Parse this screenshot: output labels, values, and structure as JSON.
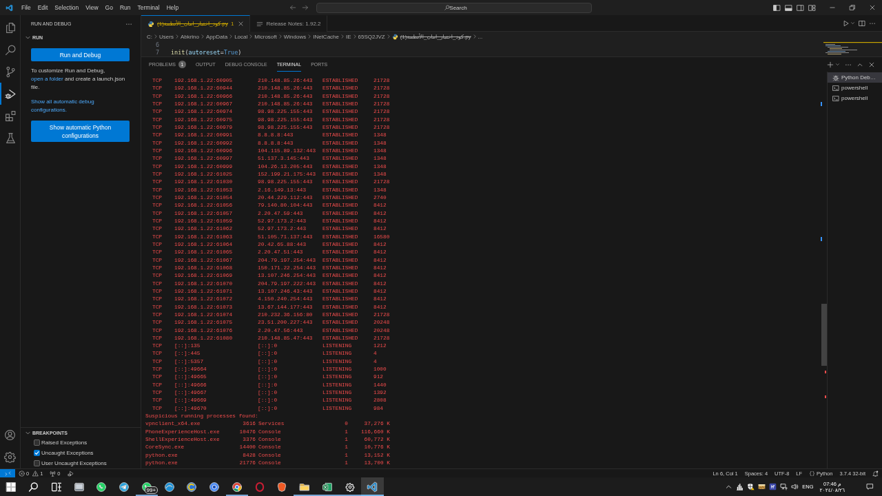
{
  "title_bar": {
    "menu": [
      "File",
      "Edit",
      "Selection",
      "View",
      "Go",
      "Run",
      "Terminal",
      "Help"
    ],
    "search": {
      "placeholder": "Search"
    }
  },
  "activity_bar": {
    "items": [
      {
        "selected": false
      },
      {
        "selected": false
      },
      {
        "selected": false
      },
      {
        "selected": true
      },
      {
        "selected": false
      },
      {
        "selected": false
      }
    ]
  },
  "sidebar": {
    "title": "RUN AND DEBUG",
    "run": {
      "title": "RUN",
      "expanded": true,
      "button": "Run and Debug",
      "intro": {
        "before": "To customize Run and Debug, ",
        "link": "open a folder",
        "after": " and create a launch.json file."
      },
      "debug_link": "Show all automatic debug configurations.",
      "python_button": "Show automatic Python configurations"
    },
    "breakpoints": {
      "title": "BREAKPOINTS",
      "expanded": true,
      "items": [
        {
          "label": "Raised Exceptions",
          "checked": false
        },
        {
          "label": "Uncaught Exceptions",
          "checked": true
        },
        {
          "label": "User Uncaught Exceptions",
          "checked": false
        }
      ]
    }
  },
  "editor": {
    "tabs": [
      {
        "kind": "file",
        "label": "كود_اختبار_امان_الأنظمة(1).py",
        "problems": "1",
        "deleted": true,
        "selected": true
      },
      {
        "kind": "preview",
        "label": "Release Notes: 1.92.2",
        "deleted": false,
        "selected": false
      }
    ],
    "breadcrumb": {
      "folders": [
        "C:",
        "Users",
        "Abkrino",
        "AppData",
        "Local",
        "Microsoft",
        "Windows",
        "INetCache",
        "IE",
        "65SQ2JVZ"
      ],
      "file": {
        "name": "كود_اختبار_امان_الأنظمة(1).py",
        "deleted": true
      },
      "symbol": "..."
    },
    "lines": [
      {
        "number": "6"
      },
      {
        "number": "7",
        "tokens": [
          {
            "kind": "function",
            "text": "init"
          },
          {
            "kind": "punctuation",
            "text": "("
          },
          {
            "kind": "parameter",
            "text": "autoreset"
          },
          {
            "kind": "operator",
            "text": "="
          },
          {
            "kind": "constant",
            "text": "True"
          },
          {
            "kind": "punctuation",
            "text": ")"
          }
        ]
      }
    ]
  },
  "panel": {
    "tabs": [
      {
        "label": "PROBLEMS",
        "badge": "1",
        "selected": false
      },
      {
        "label": "OUTPUT",
        "selected": false
      },
      {
        "label": "DEBUG CONSOLE",
        "selected": false
      },
      {
        "label": "TERMINAL",
        "selected": true
      },
      {
        "label": "PORTS",
        "selected": false
      }
    ],
    "terminal": {
      "connections": [
        {
          "protocol": "TCP",
          "local_address": "192.168.1.22:60905",
          "foreign_address": "210.148.85.26:443",
          "state": "ESTABLISHED",
          "pid": "21728"
        },
        {
          "protocol": "TCP",
          "local_address": "192.168.1.22:60944",
          "foreign_address": "210.148.85.26:443",
          "state": "ESTABLISHED",
          "pid": "21728"
        },
        {
          "protocol": "TCP",
          "local_address": "192.168.1.22:60966",
          "foreign_address": "210.148.85.26:443",
          "state": "ESTABLISHED",
          "pid": "21728"
        },
        {
          "protocol": "TCP",
          "local_address": "192.168.1.22:60967",
          "foreign_address": "210.148.85.26:443",
          "state": "ESTABLISHED",
          "pid": "21728"
        },
        {
          "protocol": "TCP",
          "local_address": "192.168.1.22:60974",
          "foreign_address": "98.98.225.155:443",
          "state": "ESTABLISHED",
          "pid": "21728"
        },
        {
          "protocol": "TCP",
          "local_address": "192.168.1.22:60975",
          "foreign_address": "98.98.225.155:443",
          "state": "ESTABLISHED",
          "pid": "21728"
        },
        {
          "protocol": "TCP",
          "local_address": "192.168.1.22:60979",
          "foreign_address": "98.98.225.155:443",
          "state": "ESTABLISHED",
          "pid": "21728"
        },
        {
          "protocol": "TCP",
          "local_address": "192.168.1.22:60991",
          "foreign_address": "8.8.8.8:443",
          "state": "ESTABLISHED",
          "pid": "1348"
        },
        {
          "protocol": "TCP",
          "local_address": "192.168.1.22:60992",
          "foreign_address": "8.8.8.8:443",
          "state": "ESTABLISHED",
          "pid": "1348"
        },
        {
          "protocol": "TCP",
          "local_address": "192.168.1.22:60996",
          "foreign_address": "104.115.89.132:443",
          "state": "ESTABLISHED",
          "pid": "1348"
        },
        {
          "protocol": "TCP",
          "local_address": "192.168.1.22:60997",
          "foreign_address": "51.137.3.145:443",
          "state": "ESTABLISHED",
          "pid": "1348"
        },
        {
          "protocol": "TCP",
          "local_address": "192.168.1.22:60999",
          "foreign_address": "104.26.13.205:443",
          "state": "ESTABLISHED",
          "pid": "1348"
        },
        {
          "protocol": "TCP",
          "local_address": "192.168.1.22:61025",
          "foreign_address": "152.199.21.175:443",
          "state": "ESTABLISHED",
          "pid": "1348"
        },
        {
          "protocol": "TCP",
          "local_address": "192.168.1.22:61030",
          "foreign_address": "98.98.225.155:443",
          "state": "ESTABLISHED",
          "pid": "21728"
        },
        {
          "protocol": "TCP",
          "local_address": "192.168.1.22:61053",
          "foreign_address": "2.16.149.13:443",
          "state": "ESTABLISHED",
          "pid": "1348"
        },
        {
          "protocol": "TCP",
          "local_address": "192.168.1.22:61054",
          "foreign_address": "20.44.229.112:443",
          "state": "ESTABLISHED",
          "pid": "2740"
        },
        {
          "protocol": "TCP",
          "local_address": "192.168.1.22:61056",
          "foreign_address": "79.140.80.104:443",
          "state": "ESTABLISHED",
          "pid": "8412"
        },
        {
          "protocol": "TCP",
          "local_address": "192.168.1.22:61057",
          "foreign_address": "2.20.47.59:443",
          "state": "ESTABLISHED",
          "pid": "8412"
        },
        {
          "protocol": "TCP",
          "local_address": "192.168.1.22:61059",
          "foreign_address": "52.97.173.2:443",
          "state": "ESTABLISHED",
          "pid": "8412"
        },
        {
          "protocol": "TCP",
          "local_address": "192.168.1.22:61062",
          "foreign_address": "52.97.173.2:443",
          "state": "ESTABLISHED",
          "pid": "8412"
        },
        {
          "protocol": "TCP",
          "local_address": "192.168.1.22:61063",
          "foreign_address": "51.105.71.137:443",
          "state": "ESTABLISHED",
          "pid": "16580"
        },
        {
          "protocol": "TCP",
          "local_address": "192.168.1.22:61064",
          "foreign_address": "20.42.65.88:443",
          "state": "ESTABLISHED",
          "pid": "8412"
        },
        {
          "protocol": "TCP",
          "local_address": "192.168.1.22:61065",
          "foreign_address": "2.20.47.51:443",
          "state": "ESTABLISHED",
          "pid": "8412"
        },
        {
          "protocol": "TCP",
          "local_address": "192.168.1.22:61067",
          "foreign_address": "204.79.197.254:443",
          "state": "ESTABLISHED",
          "pid": "8412"
        },
        {
          "protocol": "TCP",
          "local_address": "192.168.1.22:61068",
          "foreign_address": "150.171.22.254:443",
          "state": "ESTABLISHED",
          "pid": "8412"
        },
        {
          "protocol": "TCP",
          "local_address": "192.168.1.22:61069",
          "foreign_address": "13.107.246.254:443",
          "state": "ESTABLISHED",
          "pid": "8412"
        },
        {
          "protocol": "TCP",
          "local_address": "192.168.1.22:61070",
          "foreign_address": "204.79.197.222:443",
          "state": "ESTABLISHED",
          "pid": "8412"
        },
        {
          "protocol": "TCP",
          "local_address": "192.168.1.22:61071",
          "foreign_address": "13.107.246.43:443",
          "state": "ESTABLISHED",
          "pid": "8412"
        },
        {
          "protocol": "TCP",
          "local_address": "192.168.1.22:61072",
          "foreign_address": "4.150.240.254:443",
          "state": "ESTABLISHED",
          "pid": "8412"
        },
        {
          "protocol": "TCP",
          "local_address": "192.168.1.22:61073",
          "foreign_address": "13.67.144.177:443",
          "state": "ESTABLISHED",
          "pid": "8412"
        },
        {
          "protocol": "TCP",
          "local_address": "192.168.1.22:61074",
          "foreign_address": "210.232.36.156:80",
          "state": "ESTABLISHED",
          "pid": "21728"
        },
        {
          "protocol": "TCP",
          "local_address": "192.168.1.22:61075",
          "foreign_address": "23.51.200.227:443",
          "state": "ESTABLISHED",
          "pid": "20248"
        },
        {
          "protocol": "TCP",
          "local_address": "192.168.1.22:61076",
          "foreign_address": "2.20.47.56:443",
          "state": "ESTABLISHED",
          "pid": "20248"
        },
        {
          "protocol": "TCP",
          "local_address": "192.168.1.22:61080",
          "foreign_address": "210.148.85.47:443",
          "state": "ESTABLISHED",
          "pid": "21728"
        },
        {
          "protocol": "TCP",
          "local_address": "[::]:135",
          "foreign_address": "[::]:0",
          "state": "LISTENING",
          "pid": "1212"
        },
        {
          "protocol": "TCP",
          "local_address": "[::]:445",
          "foreign_address": "[::]:0",
          "state": "LISTENING",
          "pid": "4"
        },
        {
          "protocol": "TCP",
          "local_address": "[::]:5357",
          "foreign_address": "[::]:0",
          "state": "LISTENING",
          "pid": "4"
        },
        {
          "protocol": "TCP",
          "local_address": "[::]:49664",
          "foreign_address": "[::]:0",
          "state": "LISTENING",
          "pid": "1000"
        },
        {
          "protocol": "TCP",
          "local_address": "[::]:49665",
          "foreign_address": "[::]:0",
          "state": "LISTENING",
          "pid": "912"
        },
        {
          "protocol": "TCP",
          "local_address": "[::]:49666",
          "foreign_address": "[::]:0",
          "state": "LISTENING",
          "pid": "1440"
        },
        {
          "protocol": "TCP",
          "local_address": "[::]:49667",
          "foreign_address": "[::]:0",
          "state": "LISTENING",
          "pid": "1392"
        },
        {
          "protocol": "TCP",
          "local_address": "[::]:49669",
          "foreign_address": "[::]:0",
          "state": "LISTENING",
          "pid": "2808"
        },
        {
          "protocol": "TCP",
          "local_address": "[::]:49670",
          "foreign_address": "[::]:0",
          "state": "LISTENING",
          "pid": "984"
        }
      ],
      "processes_heading": "Suspicious running processes found:",
      "processes": [
        {
          "image_name": "vpnclient_x64.exe",
          "pid": "3616",
          "session_name": "Services",
          "session_number": "0",
          "mem_usage": "37,276 K"
        },
        {
          "image_name": "PhoneExperienceHost.exe",
          "pid": "10476",
          "session_name": "Console",
          "session_number": "1",
          "mem_usage": "116,660 K"
        },
        {
          "image_name": "ShellExperienceHost.exe",
          "pid": "3376",
          "session_name": "Console",
          "session_number": "1",
          "mem_usage": "60,772 K"
        },
        {
          "image_name": "CoreSync.exe",
          "pid": "14400",
          "session_name": "Console",
          "session_number": "1",
          "mem_usage": "10,776 K"
        },
        {
          "image_name": "python.exe",
          "pid": "8428",
          "session_name": "Console",
          "session_number": "1",
          "mem_usage": "13,152 K"
        },
        {
          "image_name": "python.exe",
          "pid": "21776",
          "session_name": "Console",
          "session_number": "1",
          "mem_usage": "13,700 K"
        }
      ]
    },
    "terminals": [
      {
        "kind": "debug",
        "label": "Python Deb…",
        "selected": true
      },
      {
        "kind": "shell",
        "label": "powershell",
        "selected": false
      },
      {
        "kind": "shell",
        "label": "powershell",
        "selected": false
      }
    ]
  },
  "status_bar": {
    "errors": "0",
    "warnings": "1",
    "ports": "0",
    "items": [
      "Ln 6, Col 1",
      "Spaces: 4",
      "UTF-8",
      "LF"
    ],
    "language": "Python",
    "interpreter": "3.7.4 32-bit"
  },
  "taskbar": {
    "apps": [
      {
        "running": false,
        "selected": false
      },
      {
        "running": false,
        "selected": false
      },
      {
        "running": false,
        "selected": false
      },
      {
        "running": true,
        "selected": false,
        "badge": "99+"
      },
      {
        "running": false,
        "selected": false
      },
      {
        "running": false,
        "selected": false
      },
      {
        "running": false,
        "selected": false
      },
      {
        "running": true,
        "selected": false
      },
      {
        "running": false,
        "selected": false
      },
      {
        "running": false,
        "selected": false
      },
      {
        "running": true,
        "selected": false
      },
      {
        "running": true,
        "selected": false
      },
      {
        "running": true,
        "selected": false
      },
      {
        "running": true,
        "selected": true
      }
    ],
    "language": "ENG",
    "time": "07:46 م",
    "date": "٢٠٢٤/٠٨/٢٦"
  }
}
